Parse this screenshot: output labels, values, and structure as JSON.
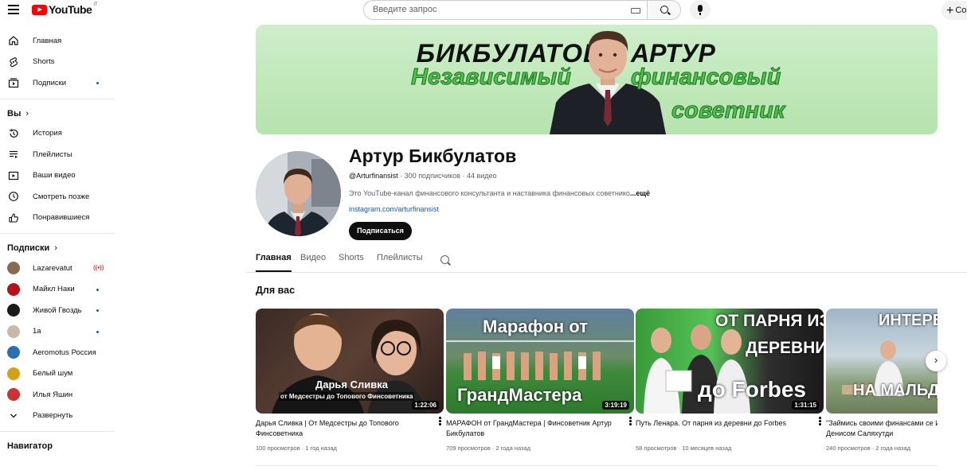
{
  "header": {
    "logo_text": "YouTube",
    "logo_country": "IT",
    "search_placeholder": "Введите запрос",
    "create_label": "Со"
  },
  "sidebar": {
    "main": [
      {
        "label": "Главная",
        "icon": "home-icon"
      },
      {
        "label": "Shorts",
        "icon": "shorts-icon"
      },
      {
        "label": "Подписки",
        "icon": "subscriptions-icon",
        "dot": true
      }
    ],
    "you_heading": "Вы",
    "you": [
      {
        "label": "История",
        "icon": "history-icon"
      },
      {
        "label": "Плейлисты",
        "icon": "playlists-icon"
      },
      {
        "label": "Ваши видео",
        "icon": "your-videos-icon"
      },
      {
        "label": "Смотреть позже",
        "icon": "watch-later-icon"
      },
      {
        "label": "Понравившиеся",
        "icon": "liked-icon"
      }
    ],
    "subs_heading": "Подписки",
    "subs": [
      {
        "label": "Lazarevatut",
        "color": "#8a6a4f",
        "live": true
      },
      {
        "label": "Майкл Наки",
        "color": "#b5121b",
        "dot": true
      },
      {
        "label": "Живой Гвоздь",
        "color": "#1a1a1a",
        "dot": true
      },
      {
        "label": "1а",
        "color": "#c8b8a8",
        "dot": true
      },
      {
        "label": "Aeromotus Россия",
        "color": "#2a6fb0"
      },
      {
        "label": "Белый шум",
        "color": "#d4a017"
      },
      {
        "label": "Илья Яшин",
        "color": "#cc3333"
      }
    ],
    "expand_label": "Развернуть",
    "navigator_heading": "Навигатор"
  },
  "banner": {
    "line1a": "БИКБУЛАТОВ",
    "line1b": "АРТУР",
    "line2a": "Независимый",
    "line2b": "финансовый",
    "line3": "советник"
  },
  "channel": {
    "name": "Артур Бикбулатов",
    "handle": "@Arturfinansist",
    "subscribers": "300 подписчиков",
    "videos": "44 видео",
    "description": "Это YouTube-канал финансового консультанта и наставника финансовых советнико",
    "more": "...ещё",
    "link": "instagram.com/arturfinansist",
    "subscribe_label": "Подписаться"
  },
  "tabs": [
    "Главная",
    "Видео",
    "Shorts",
    "Плейлисты"
  ],
  "section_title": "Для вас",
  "videos": [
    {
      "title": "Дарья Сливка | От Медсестры до Топового Финсоветника",
      "views": "100 просмотров",
      "age": "1 год назад",
      "duration": "1:22:06",
      "thumb_text1": "Дарья Сливка",
      "thumb_text2": "от Медсестры до Топового Финсоветника"
    },
    {
      "title": "МАРАФОН от ГрандМастера | Финсоветник Артур Бикбулатов",
      "views": "709 просмотров",
      "age": "2 года назад",
      "duration": "3:19:19",
      "thumb_text1": "Марафон от",
      "thumb_text2": "ГрандМастера"
    },
    {
      "title": "Путь Ленара. От парня из деревни до Forbes",
      "views": "58 просмотров",
      "age": "10 месяцев назад",
      "duration": "1:31:15",
      "thumb_text1": "ОТ ПАРНЯ ИЗ",
      "thumb_text2": "ДЕРЕВНИ",
      "thumb_text3": "до Forbes"
    },
    {
      "title": "\"Займись своими финансами се Интервью с Денисом Саляхутди",
      "views": "240 просмотров",
      "age": "2 года назад",
      "thumb_text1": "ИНТЕРВ",
      "thumb_text2": "НА МАЛЬД"
    }
  ]
}
